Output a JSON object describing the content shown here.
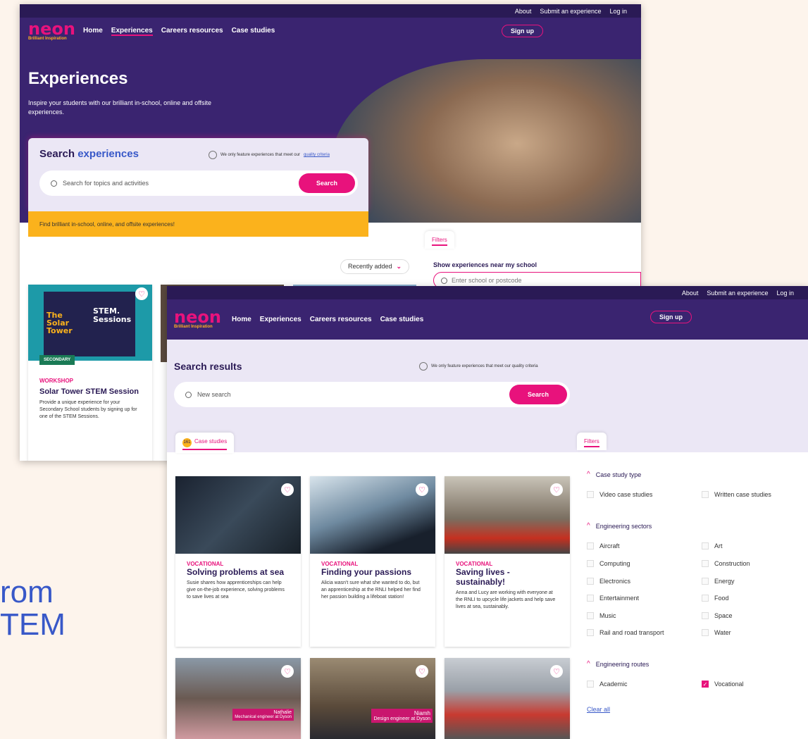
{
  "background_text": {
    "line1": "rom",
    "line2": "TEM"
  },
  "shot1": {
    "topbar": {
      "about": "About",
      "submit": "Submit an experience",
      "login": "Log in"
    },
    "logo": {
      "text": "neon",
      "sub": "Brilliant Inspiration"
    },
    "nav": [
      "Home",
      "Experiences",
      "Careers resources",
      "Case studies"
    ],
    "signup": "Sign up",
    "hero": {
      "title": "Experiences",
      "subtitle": "Inspire your students with our brilliant in-school, online and offsite experiences."
    },
    "search": {
      "title_a": "Search",
      "title_b": "experiences",
      "quality_text": "We only feature experiences that meet our",
      "quality_link": "quality criteria",
      "placeholder": "Search for topics and activities",
      "button": "Search"
    },
    "banner": "Find brilliant in-school, online, and offsite experiences!",
    "filters_tab": "Filters",
    "near_school": {
      "title": "Show experiences near my school",
      "placeholder": "Enter school or postcode"
    },
    "sort": "Recently added",
    "card": {
      "image_line1": "The\nSolar\nTower",
      "image_line2": "STEM.\nSessions",
      "badge": "SECONDARY",
      "category": "WORKSHOP",
      "title": "Solar Tower STEM Session",
      "description": "Provide a unique experience for your Secondary School students by signing up for one of the STEM Sessions."
    }
  },
  "shot2": {
    "topbar": {
      "about": "About",
      "submit": "Submit an experience",
      "login": "Log in"
    },
    "logo": {
      "text": "neon",
      "sub": "Brilliant Inspiration"
    },
    "nav": [
      "Home",
      "Experiences",
      "Careers resources",
      "Case studies"
    ],
    "signup": "Sign up",
    "title": "Search results",
    "quality_text": "We only feature experiences that meet our quality criteria",
    "search": {
      "placeholder": "New search",
      "button": "Search"
    },
    "results_tab": {
      "count": "161",
      "label": "Case studies"
    },
    "filters_tab": "Filters",
    "cards": [
      {
        "category": "VOCATIONAL",
        "title": "Solving problems at sea",
        "description": "Susie shares how apprenticeships can help give on-the-job experience, solving problems to save lives at sea"
      },
      {
        "category": "VOCATIONAL",
        "title": "Finding your passions",
        "description": "Alicia wasn't sure what she wanted to do, but an apprenticeship at the RNLI helped her find her passion building a lifeboat station!"
      },
      {
        "category": "VOCATIONAL",
        "title": "Saving lives - sustainably!",
        "description": "Anna and Lucy are working with everyone at the RNLI to upcycle life jackets and help save lives at sea, sustainably."
      }
    ],
    "cards_row2": [
      {
        "name": "Nathalie",
        "role": "Mechanical engineer at Dyson"
      },
      {
        "name": "Niamh",
        "role": "Design engineer at Dyson"
      },
      {
        "name": "",
        "role": ""
      }
    ],
    "filters": {
      "case_study_type": {
        "label": "Case study type",
        "options": [
          "Video case studies",
          "Written case studies"
        ]
      },
      "engineering_sectors": {
        "label": "Engineering sectors",
        "options": [
          "Aircraft",
          "Art",
          "Computing",
          "Construction",
          "Electronics",
          "Energy",
          "Entertainment",
          "Food",
          "Music",
          "Space",
          "Rail and road transport",
          "Water"
        ]
      },
      "engineering_routes": {
        "label": "Engineering routes",
        "options": [
          "Academic",
          "Vocational"
        ],
        "checked": "Vocational"
      },
      "clear_all": "Clear all"
    }
  },
  "colors": {
    "brand_purple": "#3a2470",
    "brand_pink": "#e8127c",
    "yellow": "#fbb21c",
    "blue": "#3858c8"
  }
}
